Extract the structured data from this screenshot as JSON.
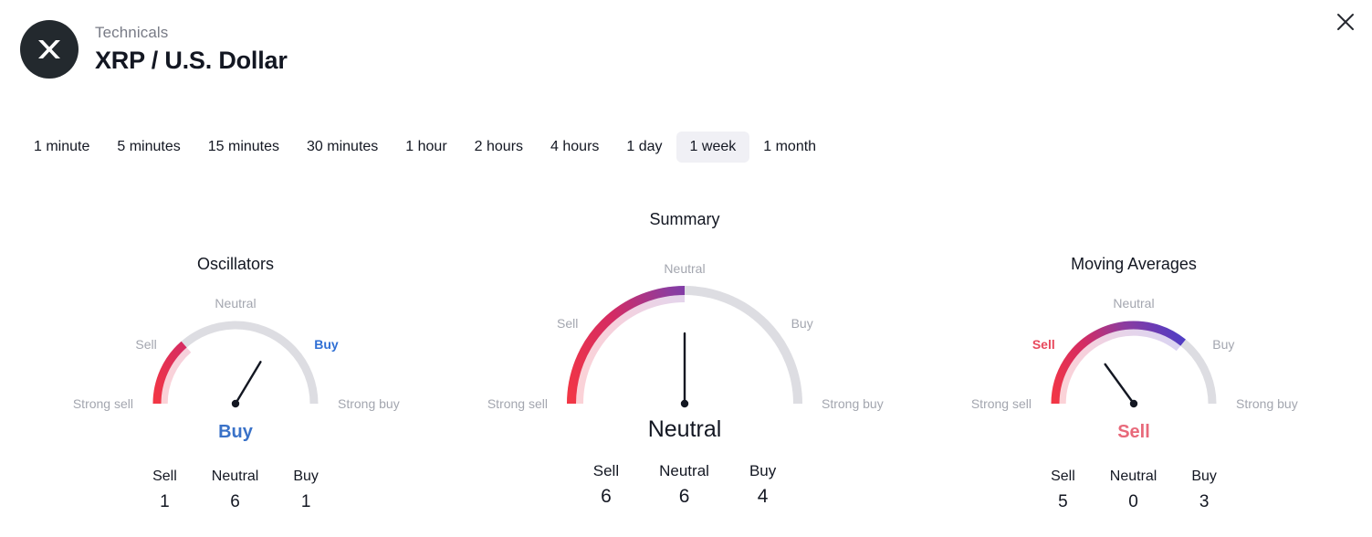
{
  "header": {
    "eyebrow": "Technicals",
    "title": "XRP / U.S. Dollar",
    "logo_icon": "xrp-logo-icon",
    "close_icon": "close-icon"
  },
  "timeframes": {
    "selected": "1 week",
    "items": [
      {
        "label": "1 minute",
        "active": false
      },
      {
        "label": "5 minutes",
        "active": false
      },
      {
        "label": "15 minutes",
        "active": false
      },
      {
        "label": "30 minutes",
        "active": false
      },
      {
        "label": "1 hour",
        "active": false
      },
      {
        "label": "2 hours",
        "active": false
      },
      {
        "label": "4 hours",
        "active": false
      },
      {
        "label": "1 day",
        "active": false
      },
      {
        "label": "1 week",
        "active": true
      },
      {
        "label": "1 month",
        "active": false
      }
    ]
  },
  "colors": {
    "sell_red": "#F23645",
    "mid_purple": "#8E3C9E",
    "buy_blue": "#4A3FC8",
    "track_gray": "#DDDDE2",
    "verdict_buy": "#3A72C8",
    "verdict_sell": "#E8697A",
    "verdict_neutral": "#131722",
    "tab_active_bg": "#F0F0F5",
    "muted_text": "#A3A6AF"
  },
  "gauges": [
    {
      "id": "oscillators",
      "title": "Oscillators",
      "verdict": "Buy",
      "verdict_class": "buy",
      "needle_angle_deg": 31,
      "arc_end_deg": 131,
      "scale_labels": {
        "strong_sell": "Strong sell",
        "sell": "Sell",
        "neutral": "Neutral",
        "buy": "Buy",
        "strong_buy": "Strong buy"
      },
      "highlight": "buy",
      "counts": [
        {
          "label": "Sell",
          "value": "1"
        },
        {
          "label": "Neutral",
          "value": "6"
        },
        {
          "label": "Buy",
          "value": "1"
        }
      ]
    },
    {
      "id": "summary",
      "title": "Summary",
      "verdict": "Neutral",
      "verdict_class": "neutral",
      "needle_angle_deg": 0,
      "arc_end_deg": 90,
      "scale_labels": {
        "strong_sell": "Strong sell",
        "sell": "Sell",
        "neutral": "Neutral",
        "buy": "Buy",
        "strong_buy": "Strong buy"
      },
      "highlight": "none",
      "counts": [
        {
          "label": "Sell",
          "value": "6"
        },
        {
          "label": "Neutral",
          "value": "6"
        },
        {
          "label": "Buy",
          "value": "4"
        }
      ]
    },
    {
      "id": "moving-averages",
      "title": "Moving Averages",
      "verdict": "Sell",
      "verdict_class": "sell",
      "needle_angle_deg": -36,
      "arc_end_deg": 51,
      "scale_labels": {
        "strong_sell": "Strong sell",
        "sell": "Sell",
        "neutral": "Neutral",
        "buy": "Buy",
        "strong_buy": "Strong buy"
      },
      "highlight": "sell",
      "counts": [
        {
          "label": "Sell",
          "value": "5"
        },
        {
          "label": "Neutral",
          "value": "0"
        },
        {
          "label": "Buy",
          "value": "3"
        }
      ]
    }
  ]
}
